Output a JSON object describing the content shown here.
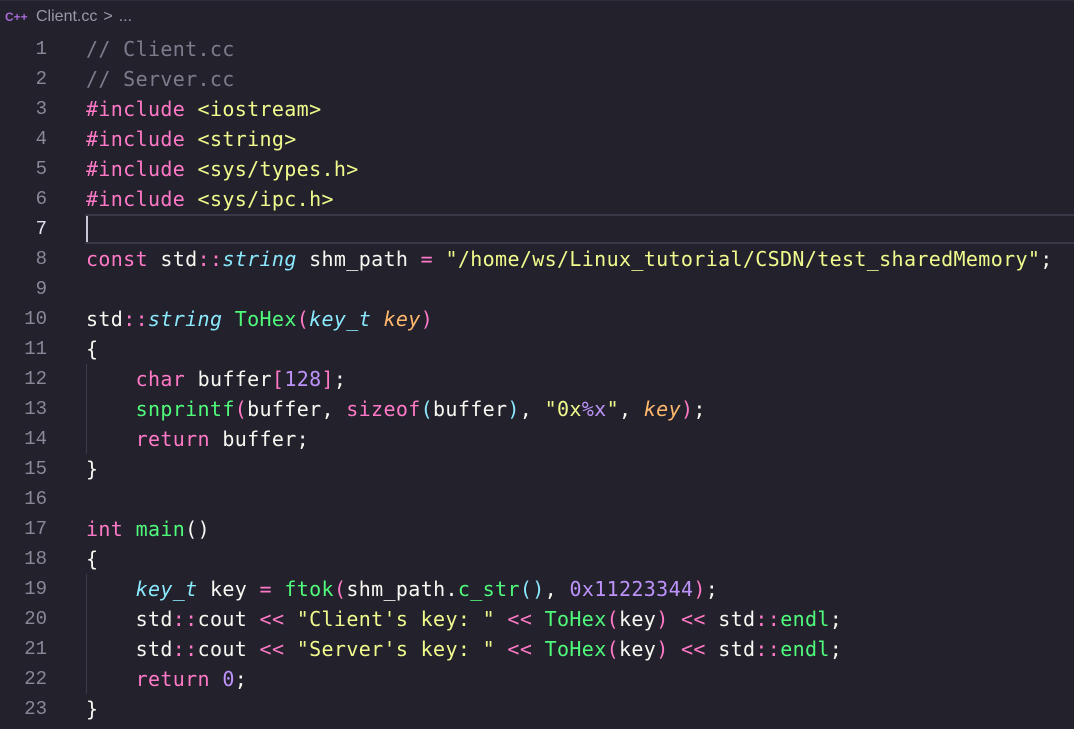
{
  "breadcrumb": {
    "icon": "cpp-file-icon",
    "icon_text": "C++",
    "file": "Client.cc",
    "separator": ">",
    "more": "..."
  },
  "editor": {
    "current_line": 7,
    "lines": [
      {
        "n": "1"
      },
      {
        "n": "2"
      },
      {
        "n": "3"
      },
      {
        "n": "4"
      },
      {
        "n": "5"
      },
      {
        "n": "6"
      },
      {
        "n": "7"
      },
      {
        "n": "8"
      },
      {
        "n": "9"
      },
      {
        "n": "10"
      },
      {
        "n": "11"
      },
      {
        "n": "12"
      },
      {
        "n": "13"
      },
      {
        "n": "14"
      },
      {
        "n": "15"
      },
      {
        "n": "16"
      },
      {
        "n": "17"
      },
      {
        "n": "18"
      },
      {
        "n": "19"
      },
      {
        "n": "20"
      },
      {
        "n": "21"
      },
      {
        "n": "22"
      },
      {
        "n": "23"
      }
    ],
    "tokens": {
      "l1": "// Client.cc",
      "l2": "// Server.cc",
      "l3_dir": "#include",
      "l3_hdr": "<iostream>",
      "l4_dir": "#include",
      "l4_hdr": "<string>",
      "l5_dir": "#include",
      "l5_hdr": "<sys/types.h>",
      "l6_dir": "#include",
      "l6_hdr": "<sys/ipc.h>",
      "l8_kw": "const",
      "l8_ns": "std",
      "l8_sc": "::",
      "l8_ty": "string",
      "l8_id": "shm_path",
      "l8_eq": "=",
      "l8_str": "\"/home/ws/Linux_tutorial/CSDN/test_sharedMemory\"",
      "l8_end": ";",
      "l10_ns": "std",
      "l10_sc": "::",
      "l10_ty": "string",
      "l10_fn": "ToHex",
      "l10_p1": "(",
      "l10_pty": "key_t",
      "l10_par": "key",
      "l10_p2": ")",
      "l11": "{",
      "l12_kw": "char",
      "l12_id": "buffer",
      "l12_b1": "[",
      "l12_nm": "128",
      "l12_b2": "]",
      "l12_end": ";",
      "l13_fn": "snprintf",
      "l13_p1": "(",
      "l13_a1": "buffer, ",
      "l13_kw": "sizeof",
      "l13_p2": "(",
      "l13_a2": "buffer",
      "l13_p3": ")",
      "l13_c": ", ",
      "l13_s1": "\"0x",
      "l13_fmt": "%x",
      "l13_s2": "\"",
      "l13_c2": ", ",
      "l13_par": "key",
      "l13_p4": ")",
      "l13_end": ";",
      "l14_kw": "return",
      "l14_id": " buffer;",
      "l15": "}",
      "l17_kw": "int",
      "l17_fn": "main",
      "l17_p": "()",
      "l18": "{",
      "l19_ty": "key_t",
      "l19_id": "key",
      "l19_eq": "=",
      "l19_fn": "ftok",
      "l19_p1": "(",
      "l19_a1": "shm_path.",
      "l19_fn2": "c_str",
      "l19_p2": "()",
      "l19_c": ", ",
      "l19_nm": "0x11223344",
      "l19_p3": ")",
      "l19_end": ";",
      "l20_ns": "std",
      "l20_sc": "::",
      "l20_id": "cout",
      "l20_op1": "<<",
      "l20_str": "\"Client's key: \"",
      "l20_op2": "<<",
      "l20_fn": "ToHex",
      "l20_p1": "(",
      "l20_a": "key",
      "l20_p2": ")",
      "l20_op3": "<<",
      "l20_ns2": "std",
      "l20_sc2": "::",
      "l20_fn2": "endl",
      "l20_end": ";",
      "l21_ns": "std",
      "l21_sc": "::",
      "l21_id": "cout",
      "l21_op1": "<<",
      "l21_str": "\"Server's key: \"",
      "l21_op2": "<<",
      "l21_fn": "ToHex",
      "l21_p1": "(",
      "l21_a": "key",
      "l21_p2": ")",
      "l21_op3": "<<",
      "l21_ns2": "std",
      "l21_sc2": "::",
      "l21_fn2": "endl",
      "l21_end": ";",
      "l22_kw": "return",
      "l22_nm": "0",
      "l22_end": ";",
      "l23": "}"
    }
  },
  "colors": {
    "background": "#22212c",
    "comment": "#7e7c8c",
    "keyword": "#ff79c6",
    "type": "#8be9fd",
    "function": "#50fa7b",
    "string": "#f1fa8c",
    "number": "#bd93f9",
    "parameter": "#ffb86c"
  }
}
